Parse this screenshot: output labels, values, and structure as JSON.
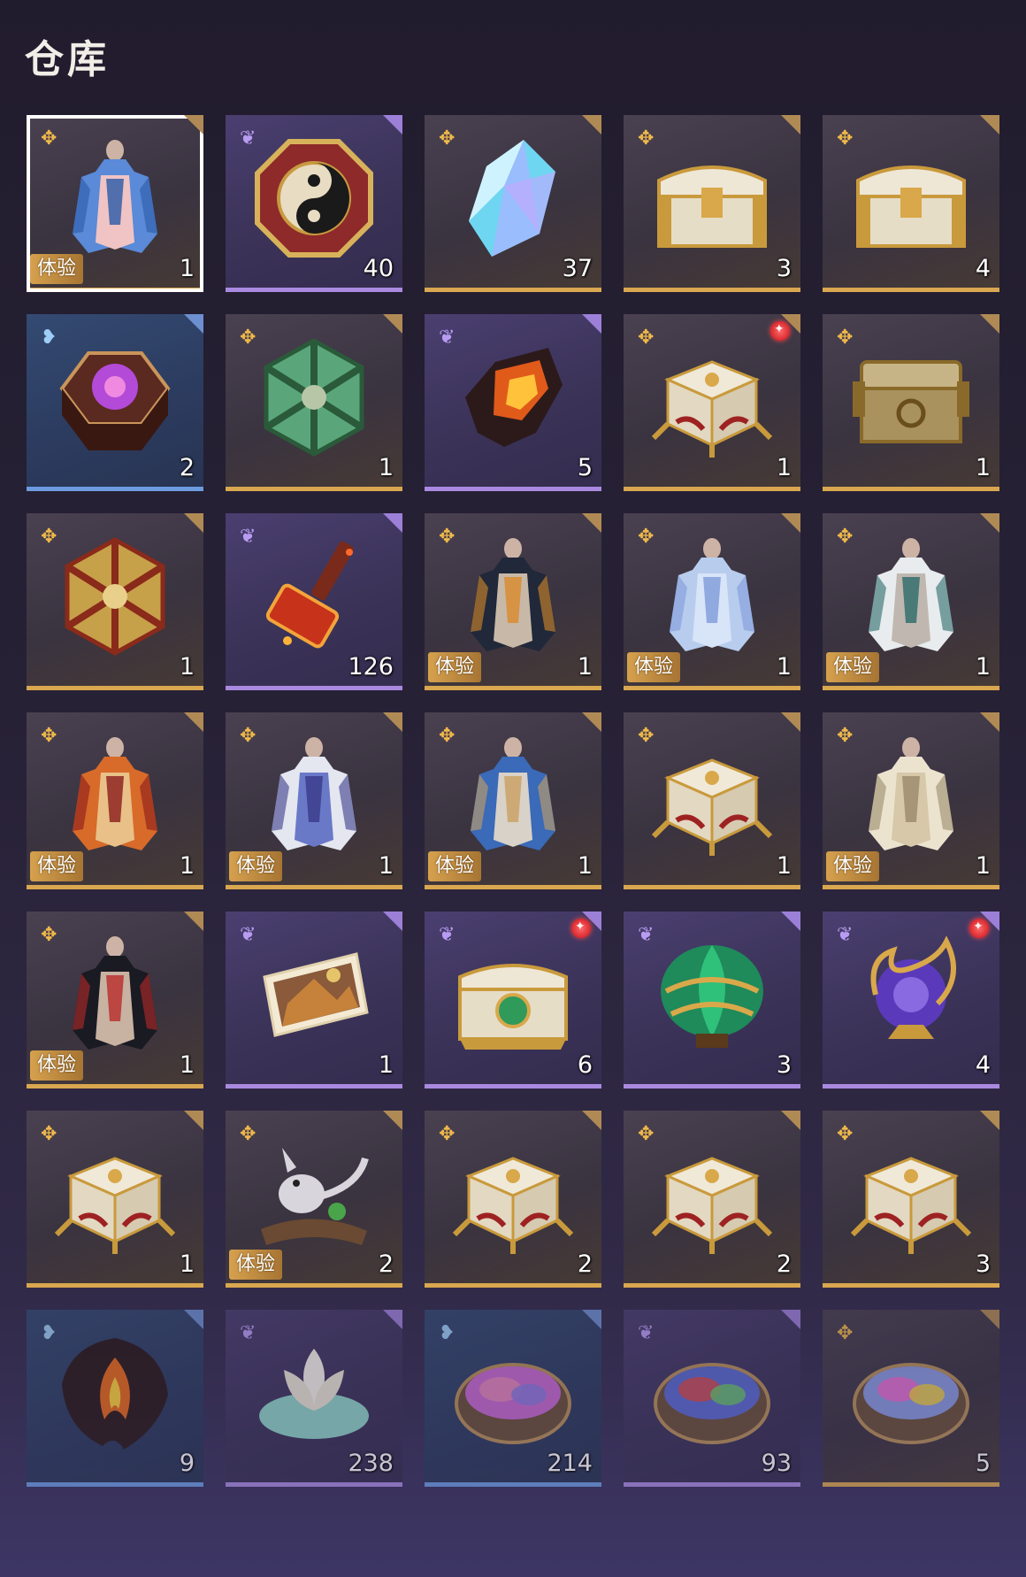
{
  "header": {
    "title": "仓库"
  },
  "colors": {
    "gold": "#d9a74f",
    "purple": "#a98ae0",
    "blue": "#6d9be0",
    "badge_red": "#d8282e"
  },
  "trial_label": "体验",
  "items": [
    {
      "name": "outfit-female-peacock",
      "rarity": "gold",
      "count": "1",
      "trial": true,
      "new": false,
      "icon": "outfit-icon",
      "selected": true,
      "dim": false
    },
    {
      "name": "yin-yang-chest",
      "rarity": "purple",
      "count": "40",
      "trial": false,
      "new": false,
      "icon": "yin-yang-box-icon",
      "selected": false,
      "dim": false
    },
    {
      "name": "crystal",
      "rarity": "gold",
      "count": "37",
      "trial": false,
      "new": false,
      "icon": "crystal-icon",
      "selected": false,
      "dim": false
    },
    {
      "name": "white-treasure-chest",
      "rarity": "gold",
      "count": "3",
      "trial": false,
      "new": false,
      "icon": "treasure-chest-icon",
      "selected": false,
      "dim": false
    },
    {
      "name": "white-treasure-chest-2",
      "rarity": "gold",
      "count": "4",
      "trial": false,
      "new": false,
      "icon": "treasure-chest-icon",
      "selected": false,
      "dim": false
    },
    {
      "name": "hexagonal-flower-box",
      "rarity": "blue",
      "count": "2",
      "trial": false,
      "new": false,
      "icon": "flower-box-icon",
      "selected": false,
      "dim": false
    },
    {
      "name": "jade-polyhedron-box",
      "rarity": "gold",
      "count": "1",
      "trial": false,
      "new": false,
      "icon": "polyhedron-box-icon",
      "selected": false,
      "dim": false
    },
    {
      "name": "fire-ore",
      "rarity": "purple",
      "count": "5",
      "trial": false,
      "new": false,
      "icon": "ore-icon",
      "selected": false,
      "dim": false
    },
    {
      "name": "ornate-white-chest",
      "rarity": "gold",
      "count": "1",
      "trial": false,
      "new": true,
      "icon": "ornate-chest-icon",
      "selected": false,
      "dim": false
    },
    {
      "name": "bronze-chest",
      "rarity": "gold",
      "count": "1",
      "trial": false,
      "new": false,
      "icon": "bronze-chest-icon",
      "selected": false,
      "dim": false
    },
    {
      "name": "golden-polyhedron-box",
      "rarity": "gold",
      "count": "1",
      "trial": false,
      "new": false,
      "icon": "polyhedron-box-icon",
      "selected": false,
      "dim": false
    },
    {
      "name": "fire-hammer",
      "rarity": "purple",
      "count": "126",
      "trial": false,
      "new": false,
      "icon": "hammer-icon",
      "selected": false,
      "dim": false
    },
    {
      "name": "outfit-male-dark",
      "rarity": "gold",
      "count": "1",
      "trial": true,
      "new": false,
      "icon": "outfit-icon",
      "selected": false,
      "dim": false
    },
    {
      "name": "outfit-female-blue",
      "rarity": "gold",
      "count": "1",
      "trial": true,
      "new": false,
      "icon": "outfit-icon",
      "selected": false,
      "dim": false
    },
    {
      "name": "outfit-male-white",
      "rarity": "gold",
      "count": "1",
      "trial": true,
      "new": false,
      "icon": "outfit-icon",
      "selected": false,
      "dim": false
    },
    {
      "name": "outfit-female-orange",
      "rarity": "gold",
      "count": "1",
      "trial": true,
      "new": false,
      "icon": "outfit-icon",
      "selected": false,
      "dim": false
    },
    {
      "name": "outfit-female-white-blue",
      "rarity": "gold",
      "count": "1",
      "trial": true,
      "new": false,
      "icon": "outfit-icon",
      "selected": false,
      "dim": false
    },
    {
      "name": "outfit-male-blue",
      "rarity": "gold",
      "count": "1",
      "trial": true,
      "new": false,
      "icon": "outfit-icon",
      "selected": false,
      "dim": false
    },
    {
      "name": "ornate-white-chest-2",
      "rarity": "gold",
      "count": "1",
      "trial": false,
      "new": false,
      "icon": "ornate-chest-icon",
      "selected": false,
      "dim": false
    },
    {
      "name": "outfit-male-robe",
      "rarity": "gold",
      "count": "1",
      "trial": true,
      "new": false,
      "icon": "outfit-icon",
      "selected": false,
      "dim": false
    },
    {
      "name": "outfit-female-red-black",
      "rarity": "gold",
      "count": "1",
      "trial": true,
      "new": false,
      "icon": "outfit-icon",
      "selected": false,
      "dim": false
    },
    {
      "name": "painting-scroll",
      "rarity": "purple",
      "count": "1",
      "trial": false,
      "new": false,
      "icon": "painting-icon",
      "selected": false,
      "dim": false
    },
    {
      "name": "jade-emblem-chest",
      "rarity": "purple",
      "count": "6",
      "trial": false,
      "new": true,
      "icon": "emblem-chest-icon",
      "selected": false,
      "dim": false
    },
    {
      "name": "emerald-lotus-orb",
      "rarity": "purple",
      "count": "3",
      "trial": false,
      "new": false,
      "icon": "lotus-orb-icon",
      "selected": false,
      "dim": false
    },
    {
      "name": "dragon-orb",
      "rarity": "purple",
      "count": "4",
      "trial": false,
      "new": true,
      "icon": "dragon-orb-icon",
      "selected": false,
      "dim": false
    },
    {
      "name": "ornate-white-chest-3",
      "rarity": "gold",
      "count": "1",
      "trial": false,
      "new": false,
      "icon": "ornate-chest-icon",
      "selected": false,
      "dim": false
    },
    {
      "name": "squirrel-pet",
      "rarity": "gold",
      "count": "2",
      "trial": true,
      "new": false,
      "icon": "squirrel-icon",
      "selected": false,
      "dim": false
    },
    {
      "name": "ornate-white-chest-4",
      "rarity": "gold",
      "count": "2",
      "trial": false,
      "new": false,
      "icon": "ornate-chest-icon",
      "selected": false,
      "dim": false
    },
    {
      "name": "ornate-white-chest-5",
      "rarity": "gold",
      "count": "2",
      "trial": false,
      "new": false,
      "icon": "ornate-chest-icon",
      "selected": false,
      "dim": false
    },
    {
      "name": "ornate-white-chest-6",
      "rarity": "gold",
      "count": "3",
      "trial": false,
      "new": false,
      "icon": "ornate-chest-icon",
      "selected": false,
      "dim": false
    },
    {
      "name": "flame-scale",
      "rarity": "blue",
      "count": "9",
      "trial": false,
      "new": false,
      "icon": "flame-scale-icon",
      "selected": false,
      "dim": true
    },
    {
      "name": "white-lotus",
      "rarity": "purple",
      "count": "238",
      "trial": false,
      "new": false,
      "icon": "lotus-icon",
      "selected": false,
      "dim": true
    },
    {
      "name": "pink-dye-bowl",
      "rarity": "blue",
      "count": "214",
      "trial": false,
      "new": false,
      "icon": "dye-bowl-icon",
      "selected": false,
      "dim": true
    },
    {
      "name": "tri-color-dye-bowl",
      "rarity": "purple",
      "count": "93",
      "trial": false,
      "new": false,
      "icon": "dye-bowl-icon",
      "selected": false,
      "dim": true
    },
    {
      "name": "rainbow-dye-bowl",
      "rarity": "gold",
      "count": "5",
      "trial": false,
      "new": false,
      "icon": "dye-bowl-icon",
      "selected": false,
      "dim": true
    }
  ]
}
